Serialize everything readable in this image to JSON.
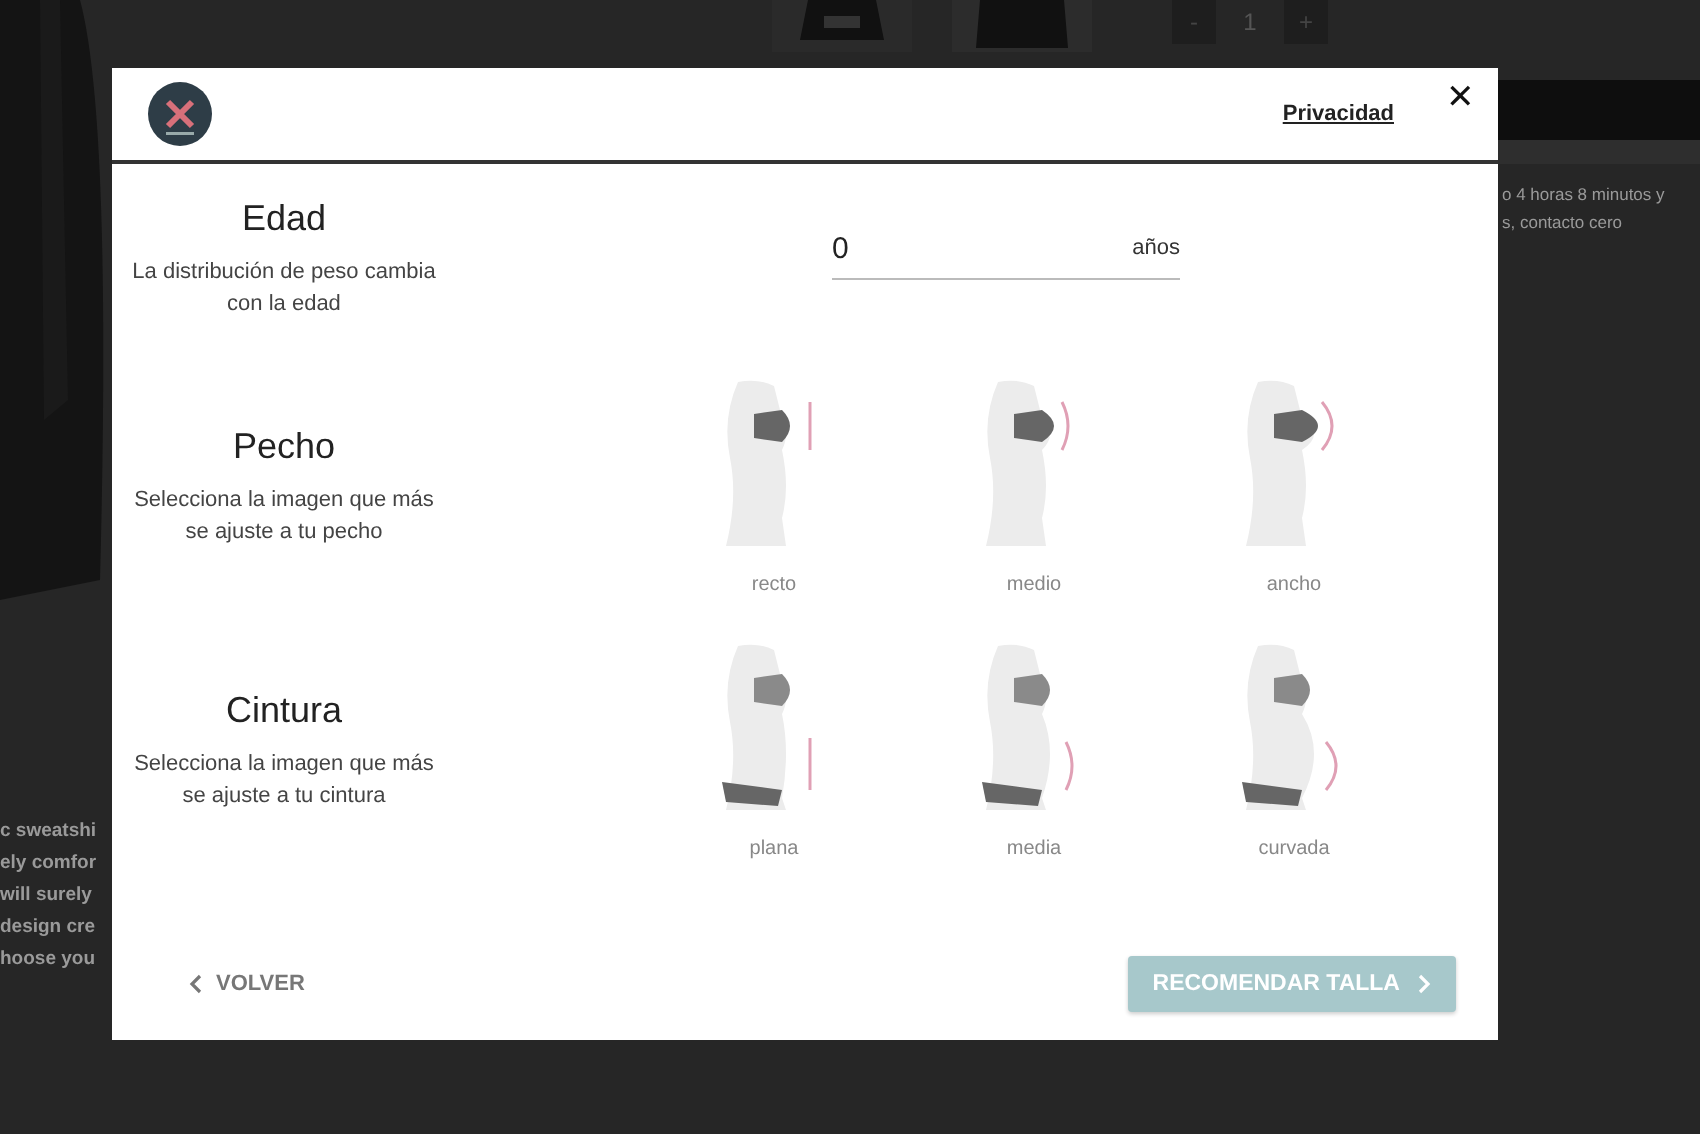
{
  "background": {
    "quantity": {
      "minus": "-",
      "value": "1",
      "plus": "+"
    },
    "left_text": [
      "c sweatshi",
      "ely comfor",
      "will surely",
      "design cre",
      "hoose you"
    ],
    "right_text": [
      "o 4 horas 8 minutos y",
      "s, contacto cero"
    ]
  },
  "modal": {
    "privacy_link": "Privacidad",
    "close": "✕",
    "sections": [
      {
        "title": "Edad",
        "description": "La distribución de peso cambia con la edad",
        "kind": "input",
        "value": "0",
        "unit": "años"
      },
      {
        "title": "Pecho",
        "description": "Selecciona la imagen que más se ajuste a tu pecho",
        "kind": "chest",
        "options": [
          {
            "label": "recto",
            "kind": "flat"
          },
          {
            "label": "medio",
            "kind": "medium"
          },
          {
            "label": "ancho",
            "kind": "curved"
          }
        ]
      },
      {
        "title": "Cintura",
        "description": "Selecciona la imagen que más se ajuste a tu cintura",
        "kind": "waist",
        "options": [
          {
            "label": "plana",
            "kind": "flat"
          },
          {
            "label": "media",
            "kind": "medium"
          },
          {
            "label": "curvada",
            "kind": "curved"
          }
        ]
      }
    ],
    "back_button": "VOLVER",
    "recommend_button": {
      "label": "RECOMENDAR TALLA",
      "disabled": true
    }
  }
}
